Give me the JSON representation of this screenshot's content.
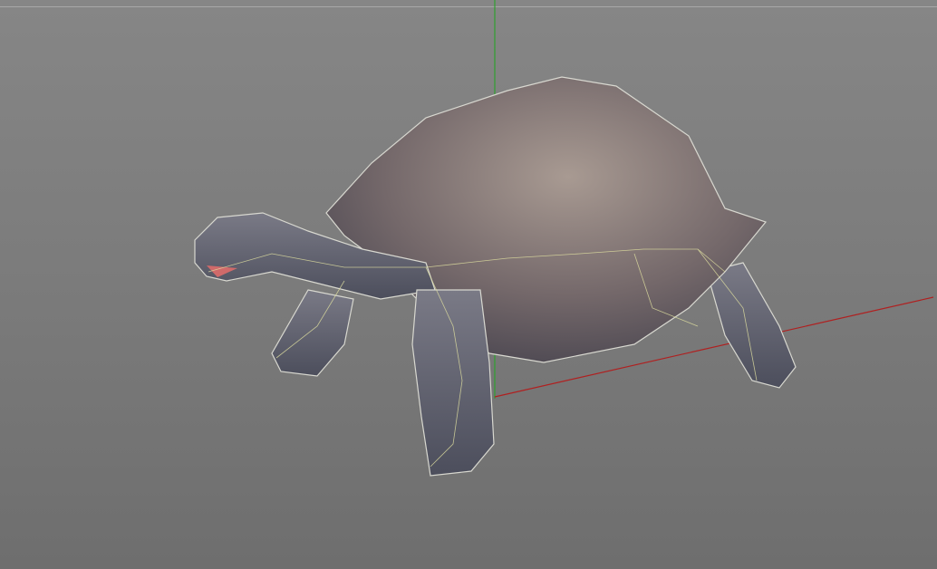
{
  "viewport": {
    "background_color": "#808080",
    "axis_colors": {
      "x": "#b02020",
      "y": "#2fa02f"
    },
    "model_icon": "tortoise-model"
  }
}
